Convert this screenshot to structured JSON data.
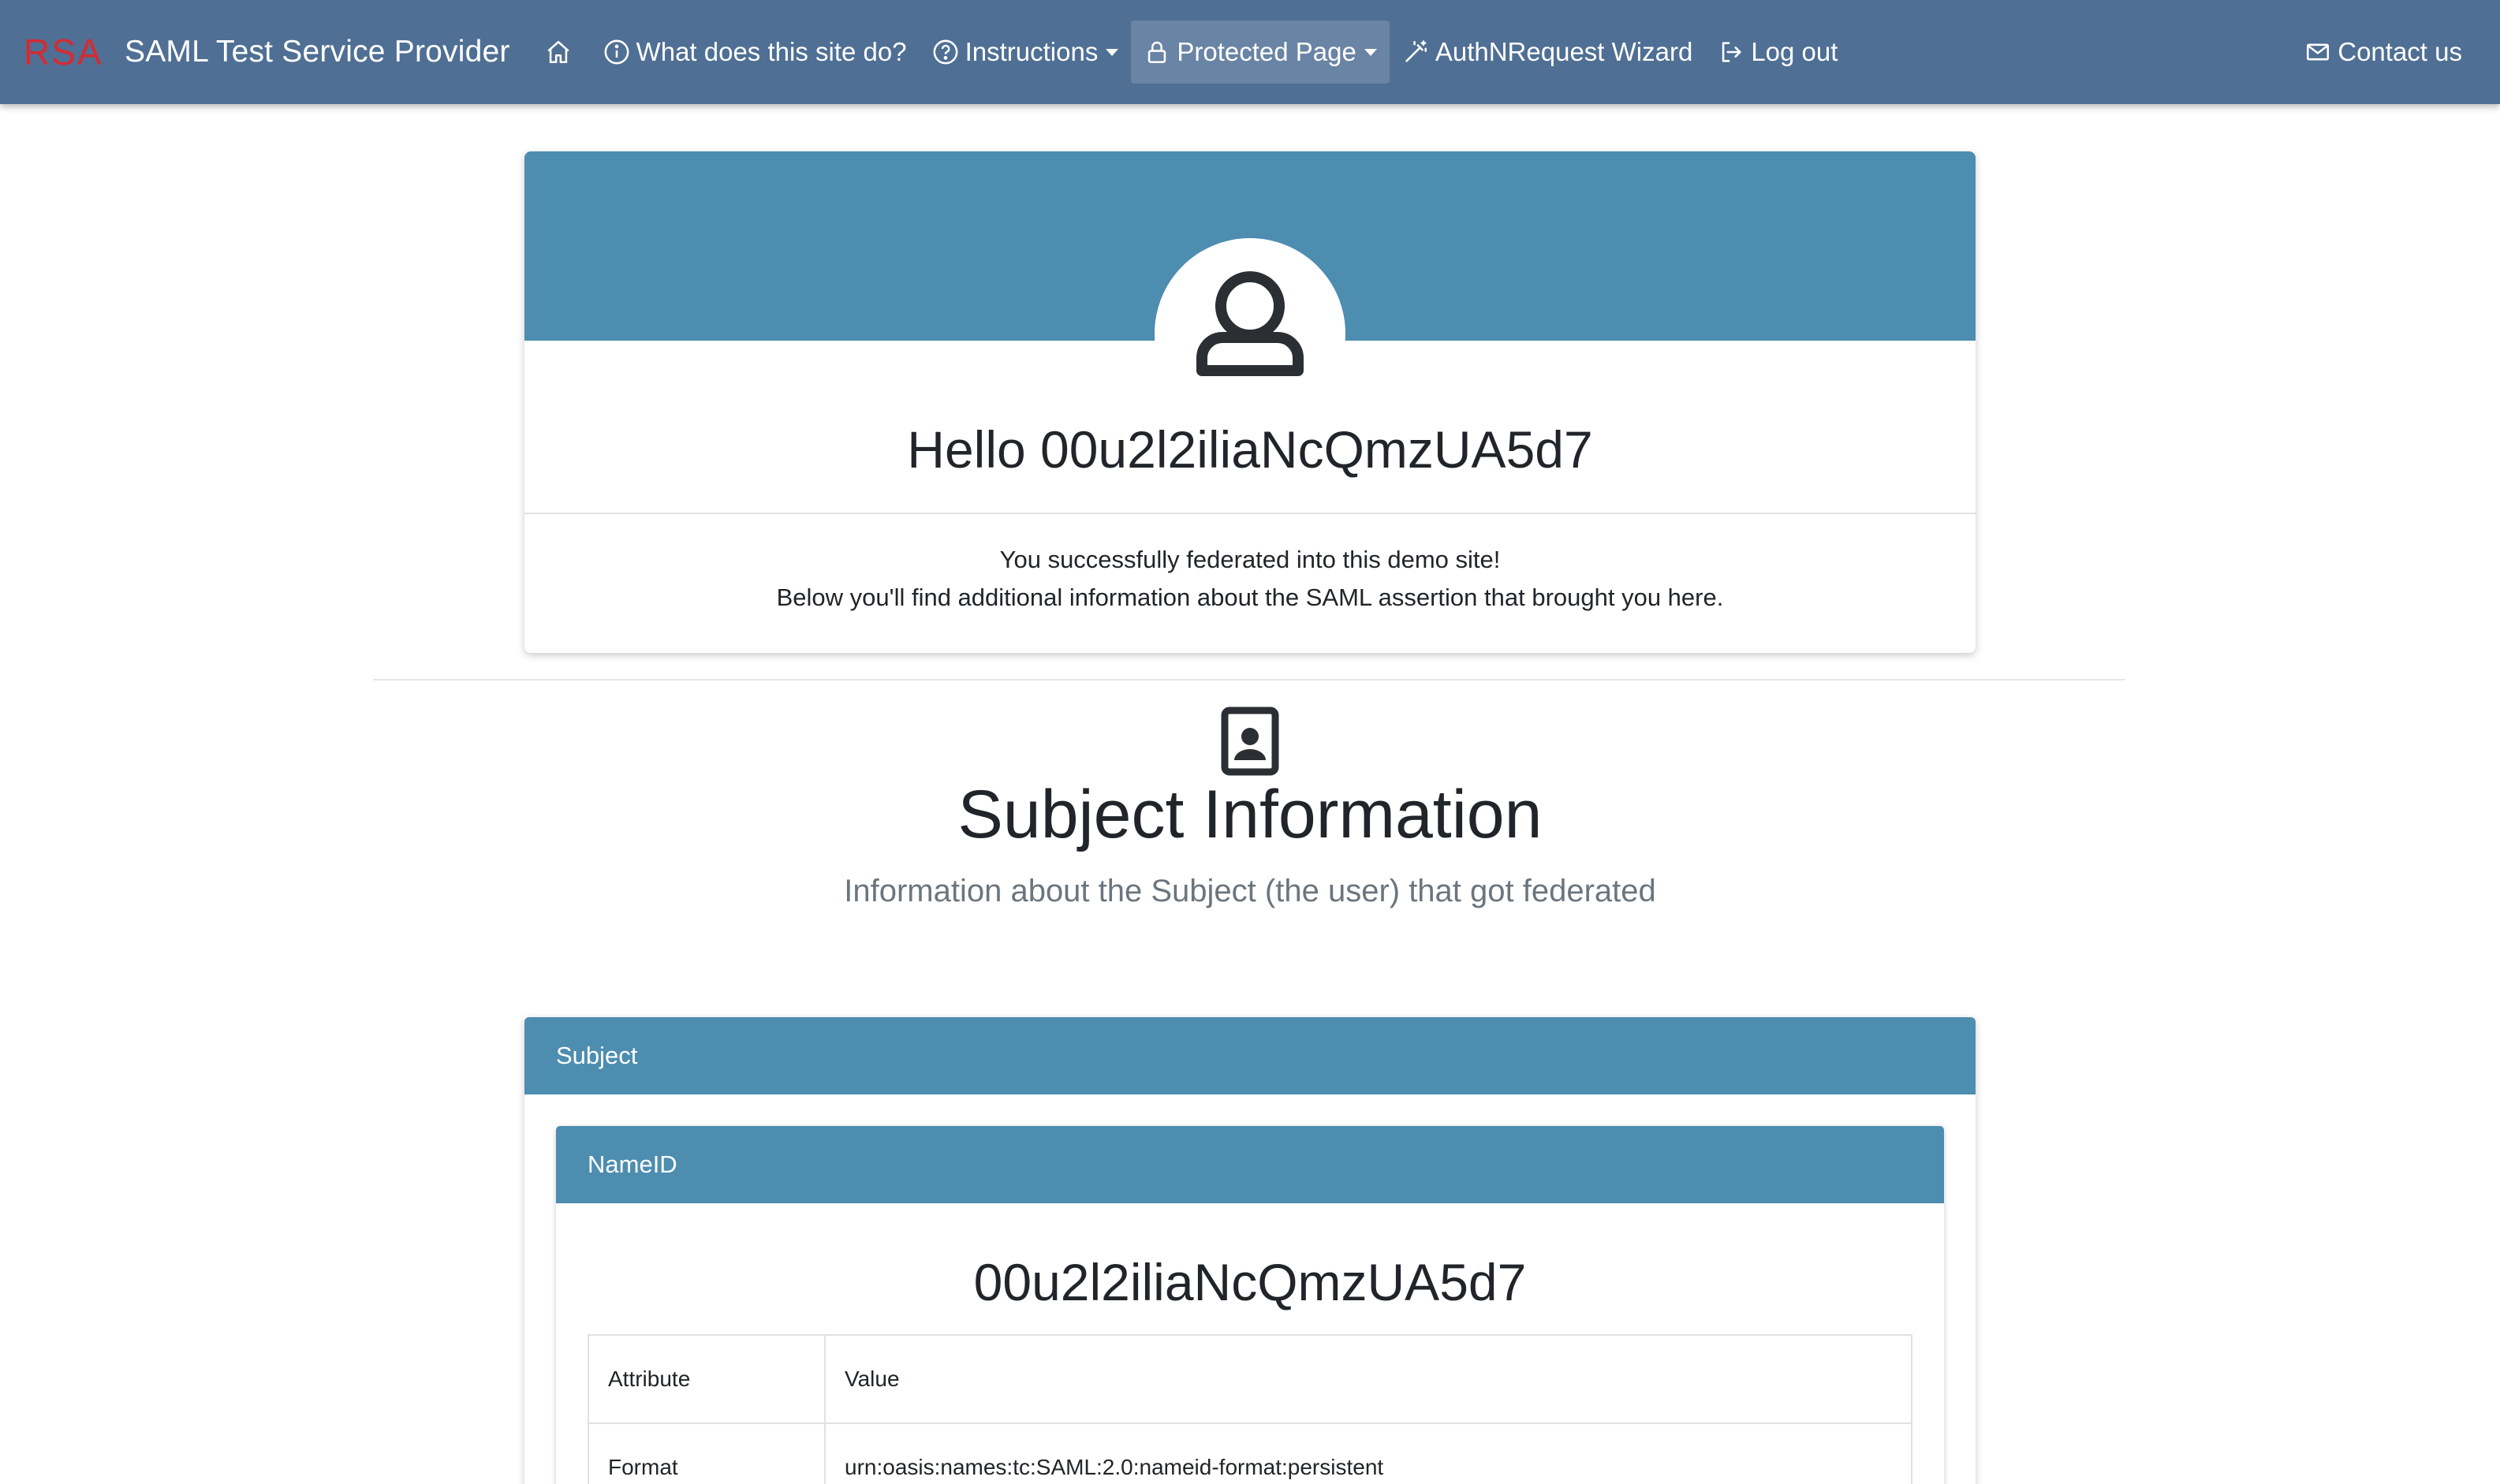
{
  "navbar": {
    "logo_text": "RSA",
    "title": "SAML Test Service Provider",
    "items": [
      {
        "label": "What does this site do?",
        "icon": "info-circle-icon"
      },
      {
        "label": "Instructions",
        "icon": "question-circle-icon"
      },
      {
        "label": "Protected Page",
        "icon": "lock-icon"
      },
      {
        "label": "AuthNRequest Wizard",
        "icon": "magic-wand-icon"
      },
      {
        "label": "Log out",
        "icon": "logout-icon"
      }
    ],
    "contact": {
      "label": "Contact us",
      "icon": "envelope-icon"
    }
  },
  "hero": {
    "greeting": "Hello 00u2l2iliaNcQmzUA5d7",
    "line1": "You successfully federated into this demo site!",
    "line2": "Below you'll find additional information about the SAML assertion that brought you here."
  },
  "subject_section": {
    "title": "Subject Information",
    "subtitle": "Information about the Subject (the user) that got federated"
  },
  "subject_card": {
    "header": "Subject",
    "nameid": {
      "header": "NameID",
      "value": "00u2l2iliaNcQmzUA5d7",
      "table": {
        "columns": [
          "Attribute",
          "Value"
        ],
        "rows": [
          {
            "attribute": "Format",
            "value": "urn:oasis:names:tc:SAML:2.0:nameid-format:persistent"
          }
        ]
      }
    }
  },
  "colors": {
    "navbar": "#4f6f94",
    "accent": "#4d8db0",
    "brand_red": "#d52b32"
  }
}
